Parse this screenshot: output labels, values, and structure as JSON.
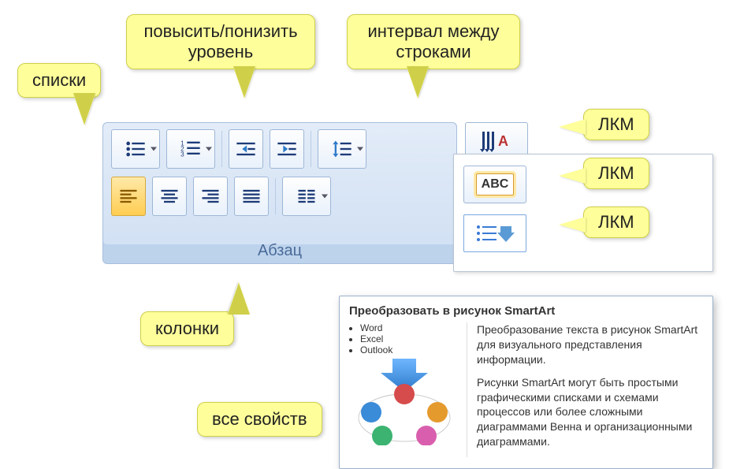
{
  "ribbon": {
    "group_label": "Абзац"
  },
  "abc_label": "ABC",
  "tooltip": {
    "title": "Преобразовать в рисунок SmartArt",
    "thumb_items": [
      "Word",
      "Excel",
      "Outlook"
    ],
    "p1": "Преобразование текста в рисунок SmartArt для визуального представления информации.",
    "p2": "Рисунки SmartArt могут быть простыми графическими списками и схемами процессов или более сложными диаграммами Венна и организационными диаграммами."
  },
  "callouts": {
    "lists": "списки",
    "indent": "повысить/понизить уровень",
    "spacing": "интервал между строками",
    "lmb1": "ЛКМ",
    "lmb2": "ЛКМ",
    "lmb3": "ЛКМ",
    "columns": "колонки",
    "allprops": "все свойств"
  }
}
